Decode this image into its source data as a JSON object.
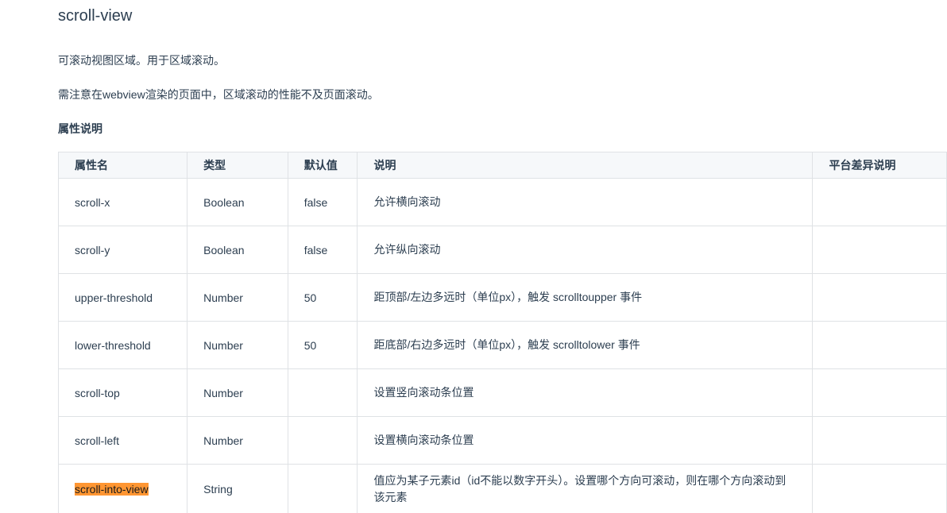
{
  "page": {
    "title": "scroll-view",
    "intro": "可滚动视图区域。用于区域滚动。",
    "note": "需注意在webview渲染的页面中，区域滚动的性能不及页面滚动。",
    "section_heading": "属性说明"
  },
  "table": {
    "headers": [
      "属性名",
      "类型",
      "默认值",
      "说明",
      "平台差异说明"
    ],
    "rows": [
      {
        "name": "scroll-x",
        "type": "Boolean",
        "default": "false",
        "desc": "允许横向滚动",
        "platform": ""
      },
      {
        "name": "scroll-y",
        "type": "Boolean",
        "default": "false",
        "desc": "允许纵向滚动",
        "platform": ""
      },
      {
        "name": "upper-threshold",
        "type": "Number",
        "default": "50",
        "desc": "距顶部/左边多远时（单位px），触发 scrolltoupper 事件",
        "platform": ""
      },
      {
        "name": "lower-threshold",
        "type": "Number",
        "default": "50",
        "desc": "距底部/右边多远时（单位px），触发 scrolltolower 事件",
        "platform": ""
      },
      {
        "name": "scroll-top",
        "type": "Number",
        "default": "",
        "desc": "设置竖向滚动条位置",
        "platform": ""
      },
      {
        "name": "scroll-left",
        "type": "Number",
        "default": "",
        "desc": "设置横向滚动条位置",
        "platform": ""
      },
      {
        "name": "scroll-into-view",
        "type": "String",
        "default": "",
        "desc": "值应为某子元素id（id不能以数字开头）。设置哪个方向可滚动，则在哪个方向滚动到该元素",
        "platform": ""
      }
    ]
  },
  "highlight_color": "#ff9632"
}
